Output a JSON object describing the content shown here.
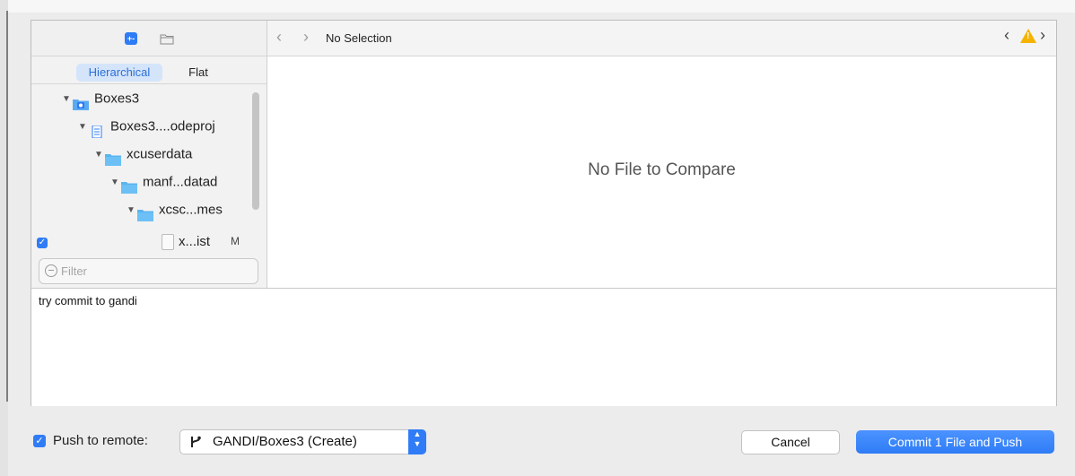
{
  "sidebar": {
    "segments": {
      "hierarchical": "Hierarchical",
      "flat": "Flat"
    },
    "tree": [
      {
        "label": "Boxes3",
        "icon": "project-icon"
      },
      {
        "label": "Boxes3....odeproj",
        "icon": "xcodeproj-icon"
      },
      {
        "label": "xcuserdata",
        "icon": "folder-icon"
      },
      {
        "label": "manf...datad",
        "icon": "folder-icon"
      },
      {
        "label": "xcsc...mes",
        "icon": "folder-icon"
      }
    ],
    "file": {
      "label": "x...ist",
      "status": "M",
      "checked": true
    },
    "filter_placeholder": "Filter"
  },
  "compare": {
    "selection": "No Selection",
    "empty_message": "No File to Compare"
  },
  "commit_message": "try commit to gandi",
  "footer": {
    "push_label": "Push to remote:",
    "push_checked": true,
    "branch": "GANDI/Boxes3 (Create)",
    "cancel_label": "Cancel",
    "commit_label": "Commit 1 File and Push"
  },
  "colors": {
    "accent": "#2f7cf6",
    "warning": "#f5b300"
  }
}
